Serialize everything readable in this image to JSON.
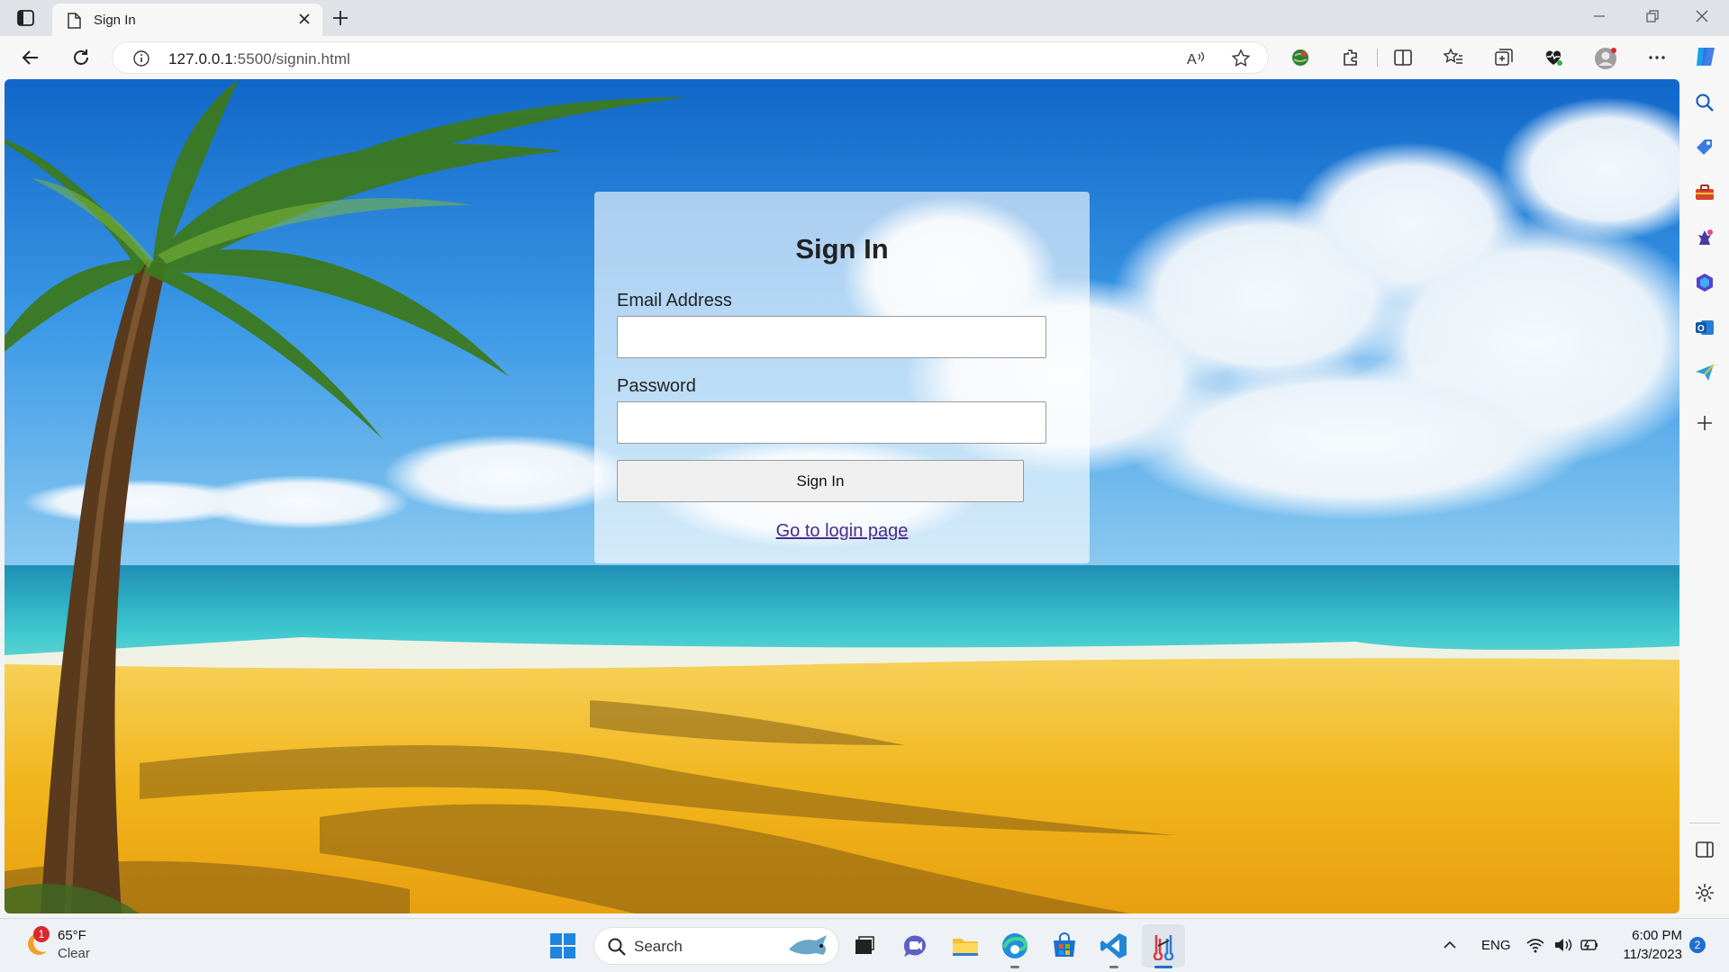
{
  "browser": {
    "tab_title": "Sign In",
    "url_host": "127.0.0.1",
    "url_path": ":5500/signin.html"
  },
  "form": {
    "heading": "Sign In",
    "email_label": "Email Address",
    "email_value": "",
    "password_label": "Password",
    "password_value": "",
    "submit_label": "Sign In",
    "login_link": "Go to login page"
  },
  "taskbar": {
    "weather_temp": "65°F",
    "weather_condition": "Clear",
    "weather_badge": "1",
    "search_placeholder": "Search",
    "language": "ENG",
    "time": "6:00 PM",
    "date": "11/3/2023",
    "notification_count": "2"
  },
  "colors": {
    "sky": "#2a8ee0",
    "sand": "#f2b81f",
    "sea": "#36c4d0",
    "link": "#4b2a8c"
  }
}
